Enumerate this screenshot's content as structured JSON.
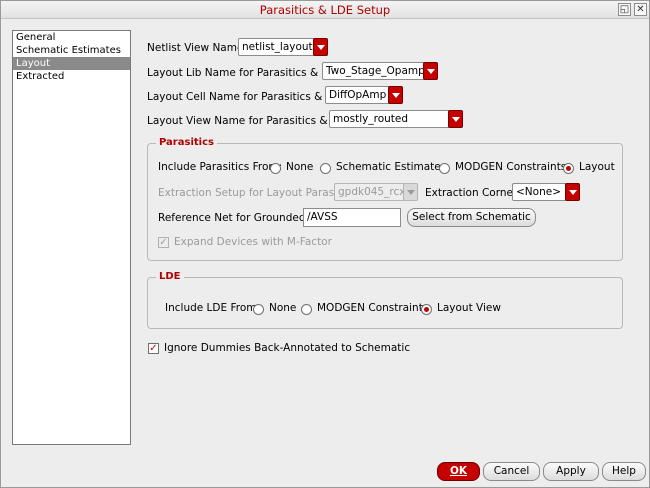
{
  "window": {
    "title": "Parasitics & LDE Setup",
    "controls": {
      "restore_icon": "restore-icon",
      "close_icon": "close-icon"
    }
  },
  "nav": {
    "items": [
      {
        "label": "General",
        "selected": false
      },
      {
        "label": "Schematic Estimates",
        "selected": false
      },
      {
        "label": "Layout",
        "selected": true
      },
      {
        "label": "Extracted",
        "selected": false
      }
    ]
  },
  "form": {
    "netlist_view": {
      "label": "Netlist View Name:",
      "value": "netlist_layout"
    },
    "lib_name": {
      "label": "Layout Lib Name for Parasitics & LDE:",
      "value": "Two_Stage_Opamp"
    },
    "cell_name": {
      "label": "Layout Cell Name for Parasitics & LDE:",
      "value": "DiffOpAmp"
    },
    "view_name": {
      "label": "Layout View Name for Parasitics & LDE:",
      "value": "mostly_routed"
    }
  },
  "parasitics": {
    "title": "Parasitics",
    "include_label": "Include Parasitics From:",
    "options": [
      "None",
      "Schematic Estimates",
      "MODGEN Constraints",
      "Layout"
    ],
    "selected": "Layout",
    "extraction_setup_label": "Extraction Setup for Layout Parasitics:",
    "extraction_setup_value": "gpdk045_rcx",
    "extraction_corner_label": "Extraction Corner:",
    "extraction_corner_value": "<None>",
    "ref_net_label": "Reference Net for Grounded C:",
    "ref_net_value": "/AVSS",
    "select_button": "Select from Schematic",
    "expand_label": "Expand Devices with M-Factor",
    "expand_checked": true
  },
  "lde": {
    "title": "LDE",
    "include_label": "Include LDE From:",
    "options": [
      "None",
      "MODGEN Constraints",
      "Layout View"
    ],
    "selected": "Layout View"
  },
  "ignore_dummies": {
    "label": "Ignore Dummies Back-Annotated to Schematic",
    "checked": true
  },
  "buttons": {
    "ok": "OK",
    "cancel": "Cancel",
    "apply": "Apply",
    "help": "Help"
  },
  "colors": {
    "accent": "#c40000",
    "title_text": "#b00000"
  }
}
